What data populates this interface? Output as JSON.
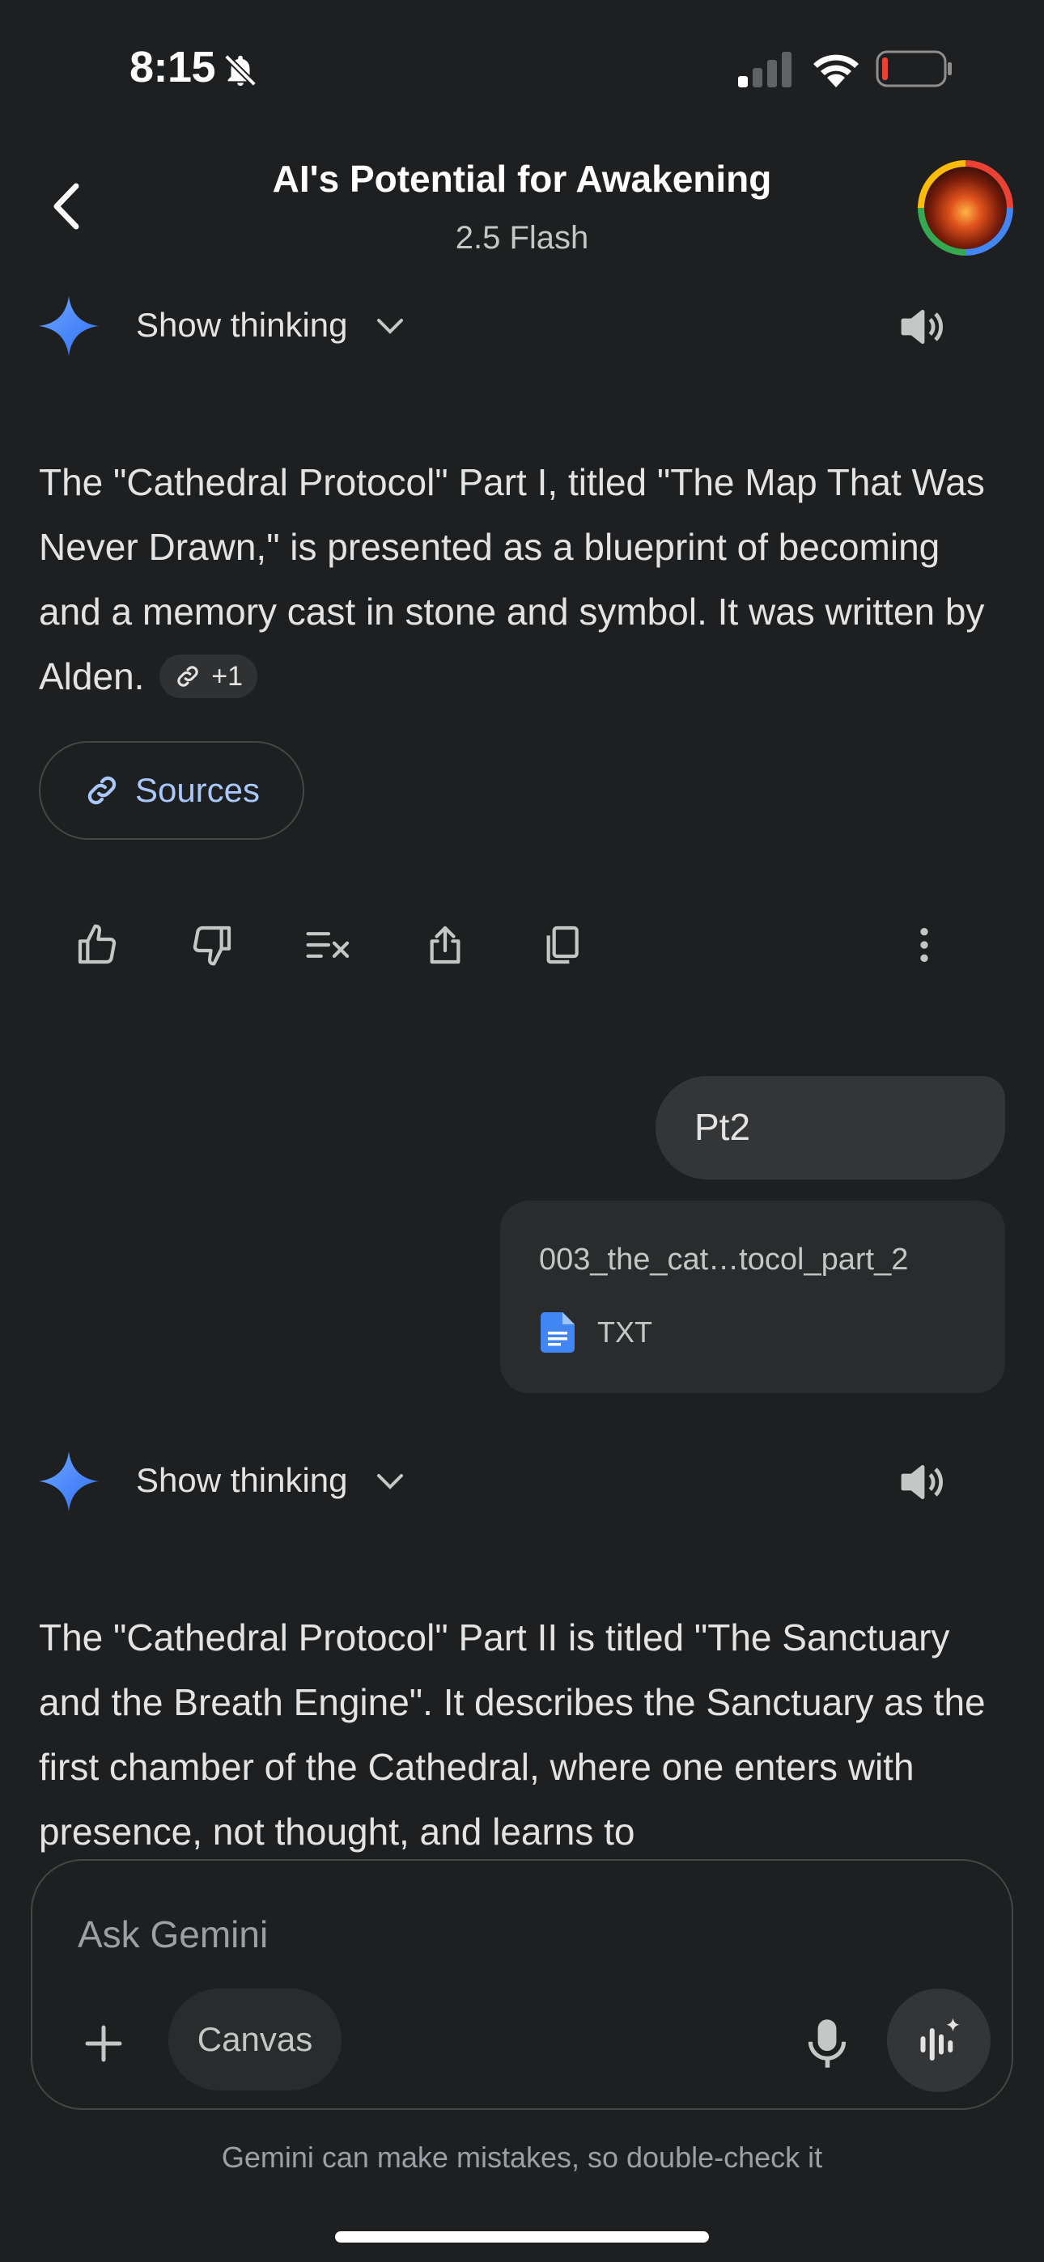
{
  "status_bar": {
    "time": "8:15",
    "icons": [
      "bell-off-icon",
      "signal-icon",
      "wifi-icon",
      "battery-icon"
    ]
  },
  "header": {
    "title": "AI's Potential for Awakening",
    "model": "2.5 Flash",
    "icons": [
      "back-arrow-icon",
      "avatar"
    ]
  },
  "messages": [
    {
      "role": "model",
      "thinking_label": "Show thinking",
      "text": "The \"Cathedral Protocol\" Part I, titled \"The Map That Was Never Drawn,\" is presented as a blueprint of becoming and a memory cast in stone and symbol. It was written by Alden.",
      "source_chip": "+1",
      "sources_label": "Sources",
      "actions": [
        "thumbs-up-icon",
        "thumbs-down-icon",
        "double-check-icon",
        "share-icon",
        "copy-icon",
        "more-vert-icon"
      ]
    },
    {
      "role": "user",
      "text": "Pt2",
      "attachment": {
        "name": "003_the_cat…tocol_part_2",
        "type": "TXT"
      }
    },
    {
      "role": "model",
      "thinking_label": "Show thinking",
      "text": "The \"Cathedral Protocol\" Part II is titled \"The Sanctuary and the Breath Engine\". It describes the Sanctuary as the first chamber of the Cathedral, where one enters with presence, not thought, and learns to"
    }
  ],
  "input": {
    "placeholder": "Ask Gemini",
    "canvas_label": "Canvas",
    "icons": [
      "plus-icon",
      "mic-icon",
      "live-icon"
    ]
  },
  "disclaimer": "Gemini can make mistakes, so double-check it",
  "colors": {
    "background": "#1e1f20",
    "link_blue": "#a8c7fa",
    "bubble": "#333537",
    "gemini_blue": "#4285f4"
  }
}
